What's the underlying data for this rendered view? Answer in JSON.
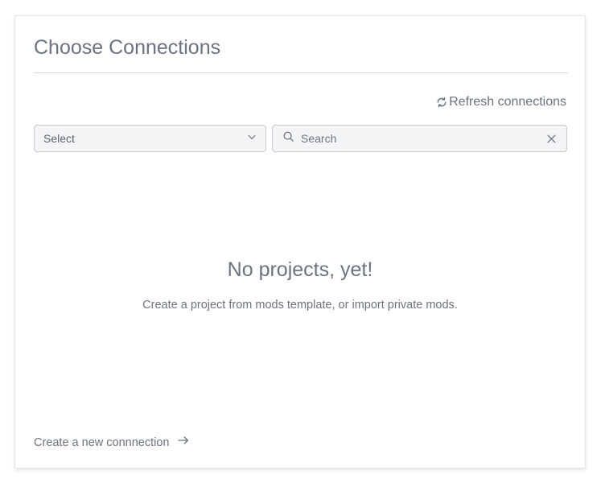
{
  "panel": {
    "title": "Choose Connections",
    "refresh_label": "Refresh connections",
    "refresh_icon": "refresh-icon"
  },
  "filters": {
    "select": {
      "value": "Select",
      "icon": "chevron-down-icon"
    },
    "search": {
      "placeholder": "Search",
      "value": "",
      "icon": "search-icon",
      "clear_icon": "close-icon"
    }
  },
  "empty_state": {
    "title": "No projects, yet!",
    "message": "Create a project from mods template, or import private mods."
  },
  "footer": {
    "create_link_label": "Create a new connnection",
    "create_link_icon": "arrow-right-icon"
  },
  "colors": {
    "text_muted": "#6b7280",
    "input_background": "#f3f4f6",
    "input_border": "#c8ccd3",
    "divider": "#d7dae0"
  }
}
